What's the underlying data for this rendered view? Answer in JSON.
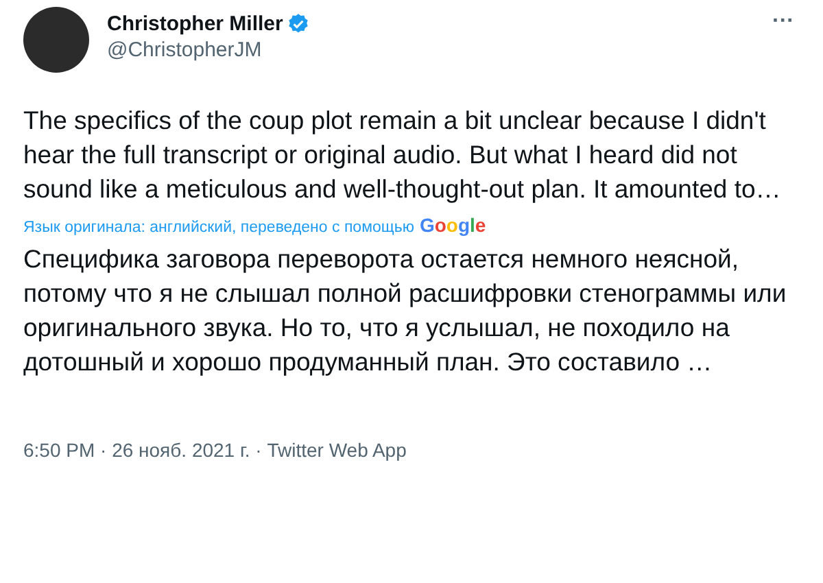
{
  "author": {
    "name": "Christopher Miller",
    "verified": true,
    "handle": "@ChristopherJM"
  },
  "more_menu": "···",
  "text": "The specifics of the coup plot remain a bit unclear because I didn't hear the full transcript or original audio. But what I heard did not sound like a meticulous and well-thought-out plan. It amounted to…",
  "translation_note": {
    "text": "Язык оригинала: английский, переведено с помощью",
    "provider": "Google"
  },
  "translated_text": "Специфика заговора переворота остается немного неясной, потому что я не слышал полной расшифровки стенограммы или оригинального звука. Но то, что я услышал, не походило на дотошный и хорошо продуманный план. Это составило …",
  "timestamp": "6:50 PM · 26 нояб. 2021 г. · Twitter Web App"
}
